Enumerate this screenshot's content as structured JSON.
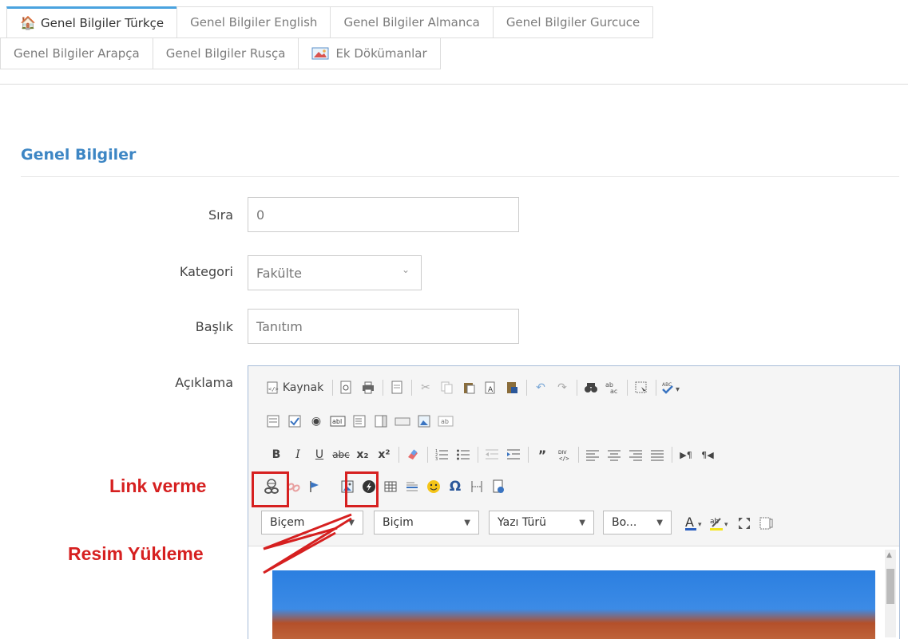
{
  "tabs": {
    "row1": [
      {
        "label": "Genel Bilgiler Türkçe",
        "icon": "home-icon",
        "active": true
      },
      {
        "label": "Genel Bilgiler English"
      },
      {
        "label": "Genel Bilgiler Almanca"
      },
      {
        "label": "Genel Bilgiler Gurcuce"
      }
    ],
    "row2": [
      {
        "label": "Genel Bilgiler Arapça"
      },
      {
        "label": "Genel Bilgiler Rusça"
      },
      {
        "label": "Ek Dökümanlar",
        "icon": "image-icon"
      }
    ]
  },
  "section": {
    "title": "Genel Bilgiler"
  },
  "form": {
    "sira": {
      "label": "Sıra",
      "value": "0"
    },
    "kategori": {
      "label": "Kategori",
      "value": "Fakülte"
    },
    "baslik": {
      "label": "Başlık",
      "value": "Tanıtım"
    },
    "aciklama": {
      "label": "Açıklama"
    }
  },
  "editor": {
    "source_label": "Kaynak",
    "format_toolbar": {
      "bold": "B",
      "italic": "I",
      "underline": "U",
      "strike": "abc",
      "subscript": "x₂",
      "superscript": "x²"
    },
    "combos": {
      "styles": "Biçem",
      "format": "Biçim",
      "font": "Yazı Türü",
      "size": "Bo..."
    }
  },
  "annotations": {
    "link": "Link verme",
    "image": "Resim Yükleme",
    "color": "#d62020"
  }
}
